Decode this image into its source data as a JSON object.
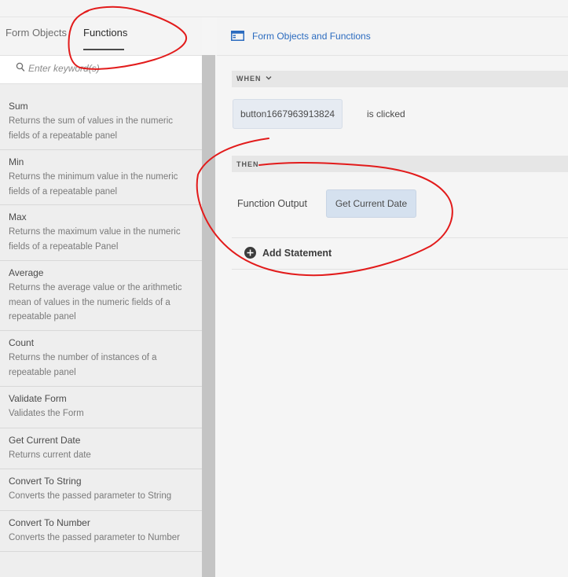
{
  "left_panel": {
    "tabs": [
      {
        "label": "Form Objects"
      },
      {
        "label": "Functions"
      }
    ],
    "search": {
      "placeholder": "Enter keyword(s)"
    },
    "functions": [
      {
        "name": "Sum",
        "description": "Returns the sum of values in the numeric fields of a repeatable panel"
      },
      {
        "name": "Min",
        "description": "Returns the minimum value in the numeric fields of a repeatable panel"
      },
      {
        "name": "Max",
        "description": "Returns the maximum value in the numeric fields of a repeatable Panel"
      },
      {
        "name": "Average",
        "description": "Returns the average value or the arithmetic mean of values in the numeric fields of a repeatable panel"
      },
      {
        "name": "Count",
        "description": "Returns the number of instances of a repeatable panel"
      },
      {
        "name": "Validate Form",
        "description": "Validates the Form"
      },
      {
        "name": "Get Current Date",
        "description": "Returns current date"
      },
      {
        "name": "Convert To String",
        "description": "Converts the passed parameter to String"
      },
      {
        "name": "Convert To Number",
        "description": "Converts the passed parameter to Number"
      }
    ]
  },
  "right_panel": {
    "header_title": "Form Objects and Functions",
    "header_icon": "panel-icon",
    "when": {
      "label": "WHEN",
      "trigger_object": "button1667963913824",
      "trigger_event": "is clicked"
    },
    "then": {
      "label": "THEN",
      "action_label": "Function Output",
      "action_value": "Get Current Date"
    },
    "add_statement_label": "Add Statement"
  },
  "colors": {
    "accent": "#2b6bbf",
    "annotation": "#e21b1b",
    "selected_value_bg": "#d5e1ef"
  }
}
